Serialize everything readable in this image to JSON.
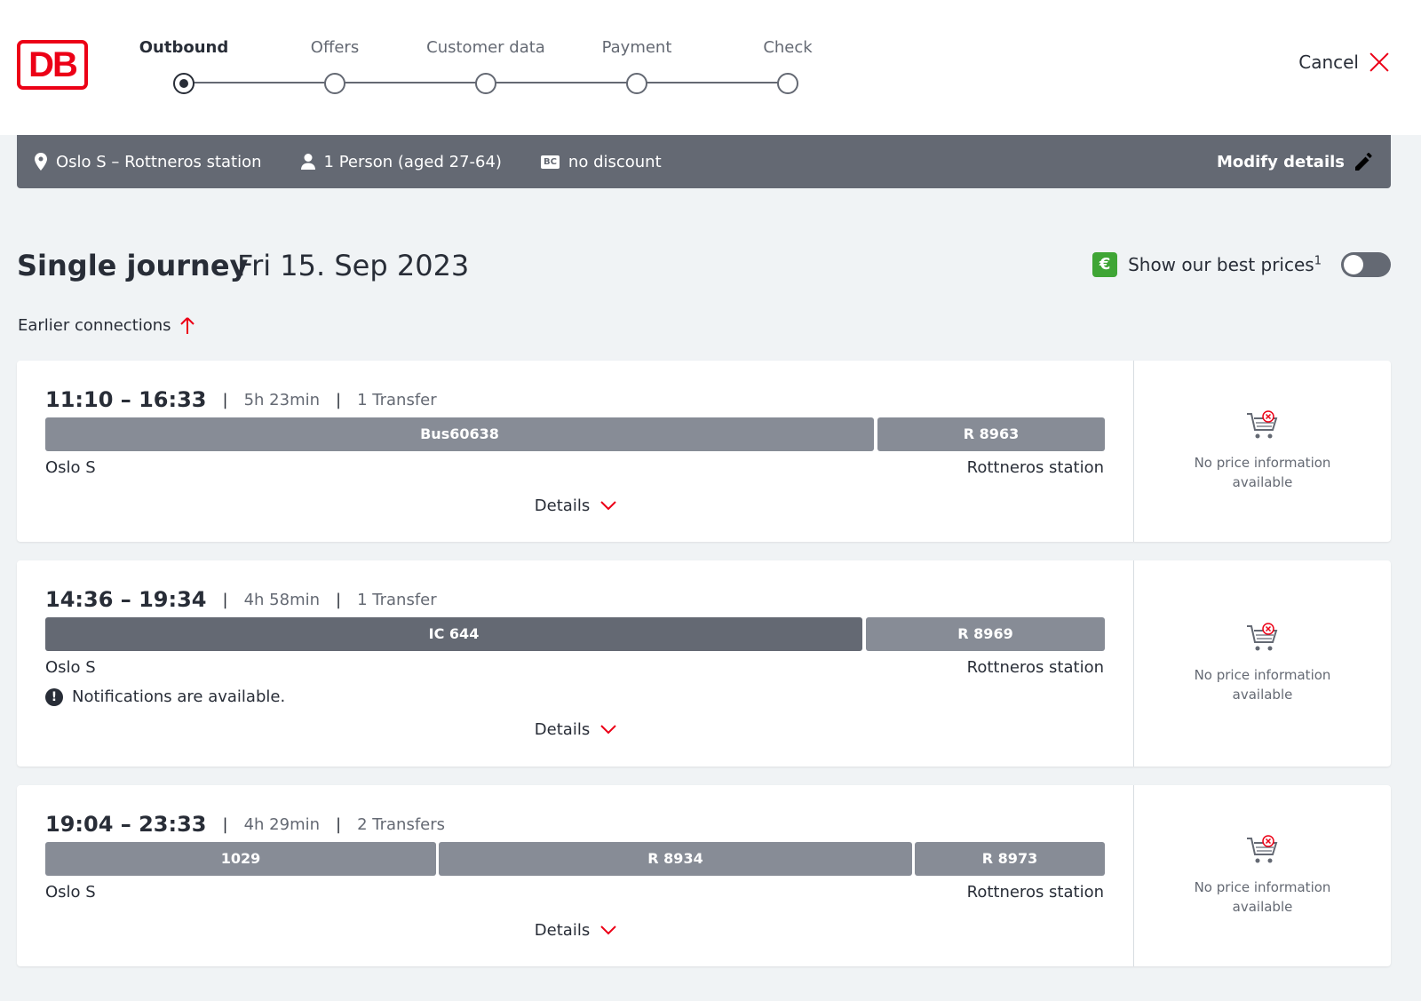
{
  "header": {
    "logo_text": "DB",
    "steps": [
      {
        "label": "Outbound",
        "active": true
      },
      {
        "label": "Offers",
        "active": false
      },
      {
        "label": "Customer data",
        "active": false
      },
      {
        "label": "Payment",
        "active": false
      },
      {
        "label": "Check",
        "active": false
      }
    ],
    "cancel_label": "Cancel"
  },
  "summary": {
    "route": "Oslo S – Rottneros station",
    "travellers": "1 Person (aged 27-64)",
    "discount_badge": "BC",
    "discount": "no discount",
    "modify_label": "Modify details"
  },
  "title": {
    "main": "Single journey",
    "date": "Fri 15. Sep 2023",
    "best_prices_icon": "€",
    "best_prices_label": "Show our best prices",
    "best_prices_footnote": "1",
    "best_prices_enabled": false
  },
  "earlier_label": "Earlier connections",
  "connections": [
    {
      "times": "11:10 – 16:33",
      "duration": "5h 23min",
      "transfers": "1 Transfer",
      "segments": [
        {
          "name": "Bus60638"
        },
        {
          "name": "R 8963"
        }
      ],
      "from": "Oslo S",
      "to": "Rottneros station",
      "notice": null,
      "details_label": "Details",
      "price_text": "No price information available"
    },
    {
      "times": "14:36 – 19:34",
      "duration": "4h 58min",
      "transfers": "1 Transfer",
      "segments": [
        {
          "name": "IC 644"
        },
        {
          "name": "R 8969"
        }
      ],
      "from": "Oslo S",
      "to": "Rottneros station",
      "notice": "Notifications are available.",
      "details_label": "Details",
      "price_text": "No price information available"
    },
    {
      "times": "19:04 – 23:33",
      "duration": "4h 29min",
      "transfers": "2 Transfers",
      "segments": [
        {
          "name": "1029"
        },
        {
          "name": "R 8934"
        },
        {
          "name": "R 8973"
        }
      ],
      "from": "Oslo S",
      "to": "Rottneros station",
      "notice": null,
      "details_label": "Details",
      "price_text": "No price information available"
    }
  ],
  "colors": {
    "brand_red": "#ec0016",
    "summary_bg": "#646973",
    "segment": "#878c96",
    "segment_dark": "#646973",
    "best_price_green": "#3fa535",
    "page_bg": "#f0f3f5"
  }
}
